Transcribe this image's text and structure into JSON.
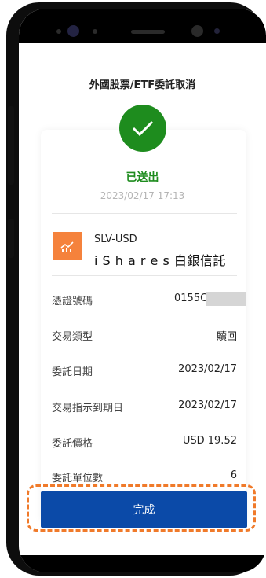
{
  "header": {
    "title": "外國股票/ETF委託取消"
  },
  "result": {
    "status": "已送出",
    "timestamp": "2023/02/17 17:13"
  },
  "fund": {
    "code": "SLV-USD",
    "name": "i S h a r e s 白銀信託",
    "icon": "chart-icon"
  },
  "details": [
    {
      "label": "憑證號碼",
      "value": "0155C"
    },
    {
      "label": "交易類型",
      "value": "贖回"
    },
    {
      "label": "委託日期",
      "value": "2023/02/17"
    },
    {
      "label": "交易指示到期日",
      "value": "2023/02/17"
    },
    {
      "label": "委託價格",
      "value": "USD 19.52"
    },
    {
      "label": "委託單位數",
      "value": "6"
    }
  ],
  "footer": {
    "done_label": "完成"
  },
  "colors": {
    "success": "#1e8c1e",
    "primary": "#0b4aa8",
    "highlight": "#f07a2a",
    "fund_icon_bg": "#f5823c"
  }
}
